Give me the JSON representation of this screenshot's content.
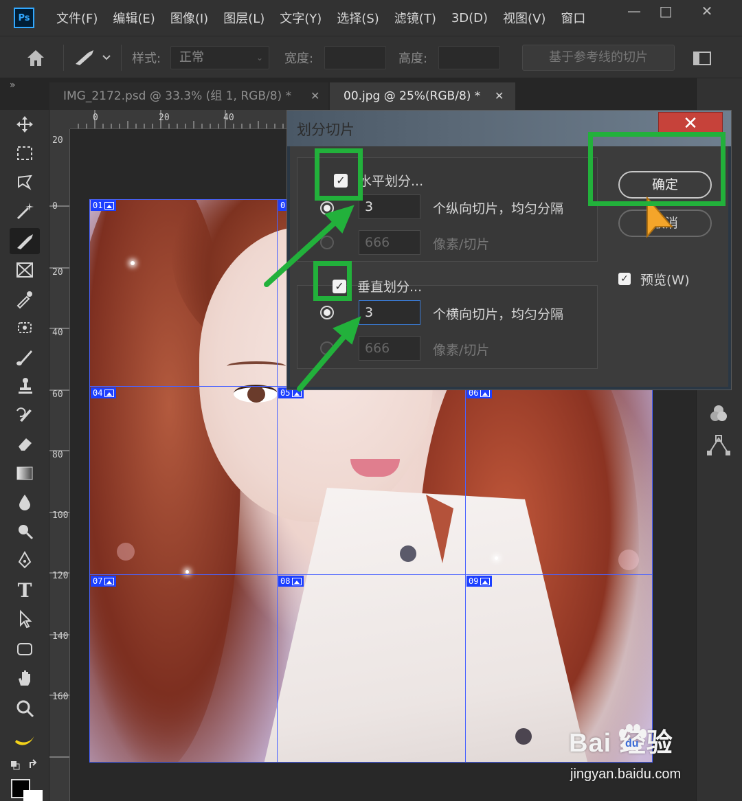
{
  "app": {
    "logo_text": "Ps",
    "menu": [
      "文件(F)",
      "编辑(E)",
      "图像(I)",
      "图层(L)",
      "文字(Y)",
      "选择(S)",
      "滤镜(T)",
      "3D(D)",
      "视图(V)",
      "窗口"
    ],
    "window_controls": {
      "minimize": "—",
      "restore": "□",
      "close": "✕"
    }
  },
  "options_bar": {
    "style_label": "样式:",
    "style_value": "正常",
    "width_label": "宽度:",
    "height_label": "高度:",
    "guides_button": "基于参考线的切片"
  },
  "tabs": [
    {
      "label": "IMG_2172.psd @ 33.3% (组 1, RGB/8) *",
      "close": "✕",
      "active": false
    },
    {
      "label": "00.jpg @ 25%(RGB/8) *",
      "close": "✕",
      "active": true
    }
  ],
  "panel_collapse": {
    "left": "»",
    "right": "«"
  },
  "rulers": {
    "horizontal": [
      "0",
      "20",
      "40"
    ],
    "vertical": [
      "20",
      "0",
      "20",
      "40",
      "60",
      "80",
      "100",
      "120",
      "140",
      "160"
    ]
  },
  "slices": {
    "tags": [
      "01",
      "0",
      "04",
      "05",
      "06",
      "07",
      "08",
      "09"
    ]
  },
  "dialog": {
    "title": "划分切片",
    "close": "✕",
    "horizontal": {
      "checkbox_label": "水平划分...",
      "checked": true,
      "count_value": "3",
      "count_suffix": "个纵向切片，均匀分隔",
      "pixel_value": "666",
      "pixel_suffix": "像素/切片"
    },
    "vertical": {
      "checkbox_label": "垂直划分...",
      "checked": true,
      "count_value": "3",
      "count_suffix": "个横向切片，均匀分隔",
      "pixel_value": "666",
      "pixel_suffix": "像素/切片"
    },
    "ok_button": "确定",
    "cancel_button": "取消",
    "preview_label": "预览(W)",
    "preview_checked": true
  },
  "watermark": {
    "brand": "Bai  经验",
    "brand_du": "du",
    "url": "jingyan.baidu.com"
  },
  "colors": {
    "annotation_green": "#22b13b",
    "slice_blue": "#1c3fff",
    "ps_blue": "#31a8ff"
  }
}
